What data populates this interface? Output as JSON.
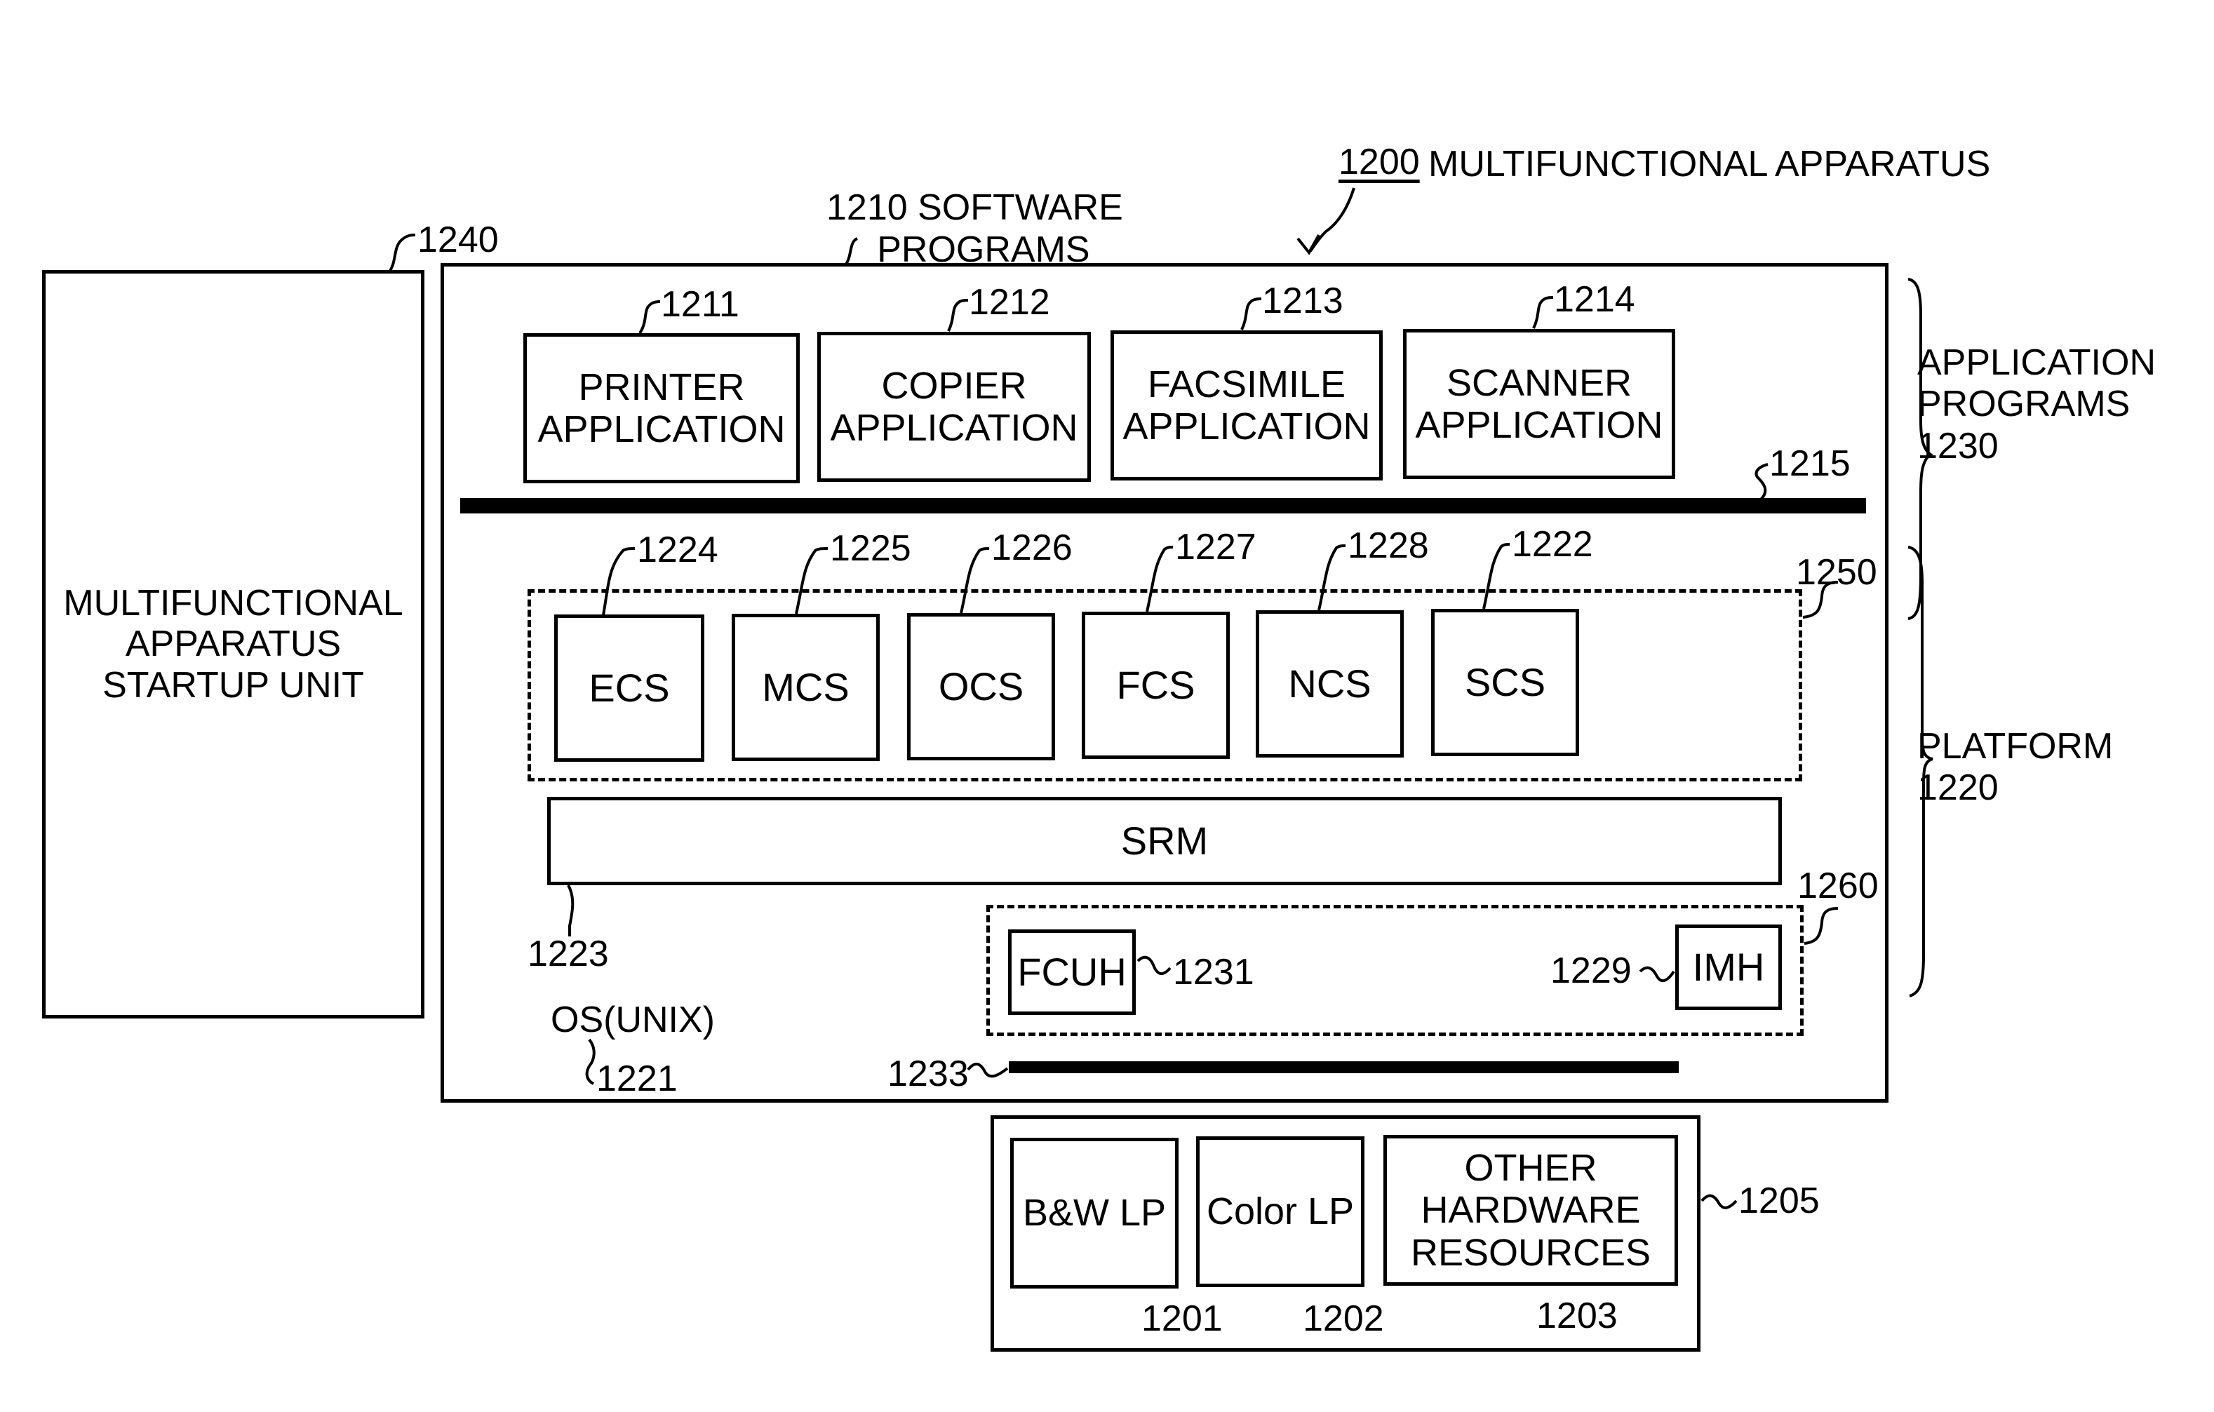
{
  "apparatus": {
    "ref": "1200",
    "label": "MULTIFUNCTIONAL\nAPPARATUS"
  },
  "software": {
    "ref_label": "1210 SOFTWARE\n     PROGRAMS"
  },
  "startup_unit": {
    "ref": "1240",
    "label": "MULTIFUNCTIONAL\nAPPARATUS\nSTARTUP UNIT"
  },
  "applications": [
    {
      "ref": "1211",
      "label": "PRINTER\nAPPLICATION"
    },
    {
      "ref": "1212",
      "label": "COPIER\nAPPLICATION"
    },
    {
      "ref": "1213",
      "label": "FACSIMILE\nAPPLICATION"
    },
    {
      "ref": "1214",
      "label": "SCANNER\nAPPLICATION"
    }
  ],
  "api_bar": {
    "ref": "1215"
  },
  "application_programs": {
    "label": "APPLICATION\nPROGRAMS\n1230"
  },
  "platform": {
    "label": "PLATFORM\n1220"
  },
  "control_services": {
    "ref": "1250",
    "items": [
      {
        "ref": "1224",
        "label": "ECS"
      },
      {
        "ref": "1225",
        "label": "MCS"
      },
      {
        "ref": "1226",
        "label": "OCS"
      },
      {
        "ref": "1227",
        "label": "FCS"
      },
      {
        "ref": "1228",
        "label": "NCS"
      },
      {
        "ref": "1222",
        "label": "SCS"
      }
    ]
  },
  "srm": {
    "ref": "1223",
    "label": "SRM"
  },
  "handlers": {
    "ref": "1260",
    "fcuh": {
      "ref": "1231",
      "label": "FCUH"
    },
    "imh": {
      "ref": "1229",
      "label": "IMH"
    }
  },
  "os": {
    "label": "OS(UNIX)",
    "ref": "1221"
  },
  "engine_bar": {
    "ref": "1233"
  },
  "hardware": {
    "ref": "1205",
    "items": [
      {
        "ref": "1201",
        "label": "B&W LP"
      },
      {
        "ref": "1202",
        "label": "Color LP"
      },
      {
        "ref": "1203",
        "label": "OTHER\nHARDWARE\nRESOURCES"
      }
    ]
  }
}
